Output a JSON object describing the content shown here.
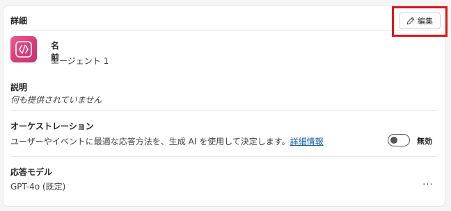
{
  "details": {
    "title": "詳細",
    "edit_label": "編集"
  },
  "agent": {
    "name_label": "名前",
    "name_value": "エージェント 1",
    "icon": "code-brackets-icon",
    "icon_color": "#d63e7a"
  },
  "description": {
    "label": "説明",
    "value": "何も提供されていません"
  },
  "orchestration": {
    "label": "オーケストレーション",
    "text": "ユーザーやイベントに最適な応答方法を、生成 AI を使用して決定します。",
    "link": "詳細情報",
    "toggle_state": "off",
    "toggle_label": "無効"
  },
  "model": {
    "label": "応答モデル",
    "value": "GPT-4o (既定)",
    "more": "···"
  },
  "colors": {
    "highlight": "#e31414",
    "link": "#115ea3"
  }
}
